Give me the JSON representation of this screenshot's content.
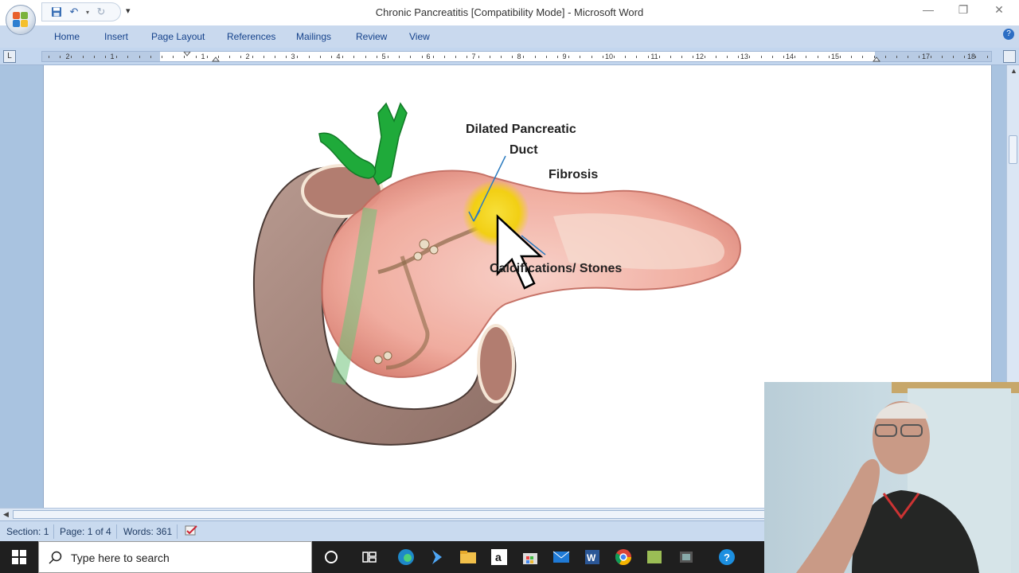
{
  "window": {
    "title": "Chronic Pancreatitis [Compatibility Mode] - Microsoft Word",
    "minimize_glyph": "—",
    "restore_glyph": "❐",
    "close_glyph": "✕"
  },
  "ribbon": {
    "tabs": [
      "Home",
      "Insert",
      "Page Layout",
      "References",
      "Mailings",
      "Review",
      "View"
    ],
    "help_glyph": "?"
  },
  "ruler": {
    "corner_glyph": "L",
    "labels": [
      "2",
      "1",
      "1",
      "2",
      "3",
      "4",
      "5",
      "6",
      "7",
      "8",
      "9",
      "10",
      "11",
      "12",
      "13",
      "14",
      "15",
      "17",
      "18"
    ]
  },
  "figure": {
    "labels": {
      "dilated_duct_line1": "Dilated Pancreatic",
      "dilated_duct_line2": "Duct",
      "fibrosis": "Fibrosis",
      "calcifications": "Calcifications/ Stones"
    }
  },
  "status": {
    "section": "Section: 1",
    "page": "Page: 1 of 4",
    "words": "Words: 361"
  },
  "taskbar": {
    "search_placeholder": "Type here to search",
    "icons": [
      "cortana-icon",
      "task-view-icon",
      "edge-icon",
      "visual-studio-icon",
      "file-explorer-icon",
      "amazon-icon",
      "store-icon",
      "mail-icon",
      "word-icon",
      "chrome-icon",
      "notes-icon",
      "app-icon",
      "help-icon"
    ]
  },
  "colors": {
    "ribbon_bg": "#c9d9ee",
    "tab_text": "#15428b",
    "highlight": "#f2d21b",
    "bile_duct": "#1faa3a"
  }
}
